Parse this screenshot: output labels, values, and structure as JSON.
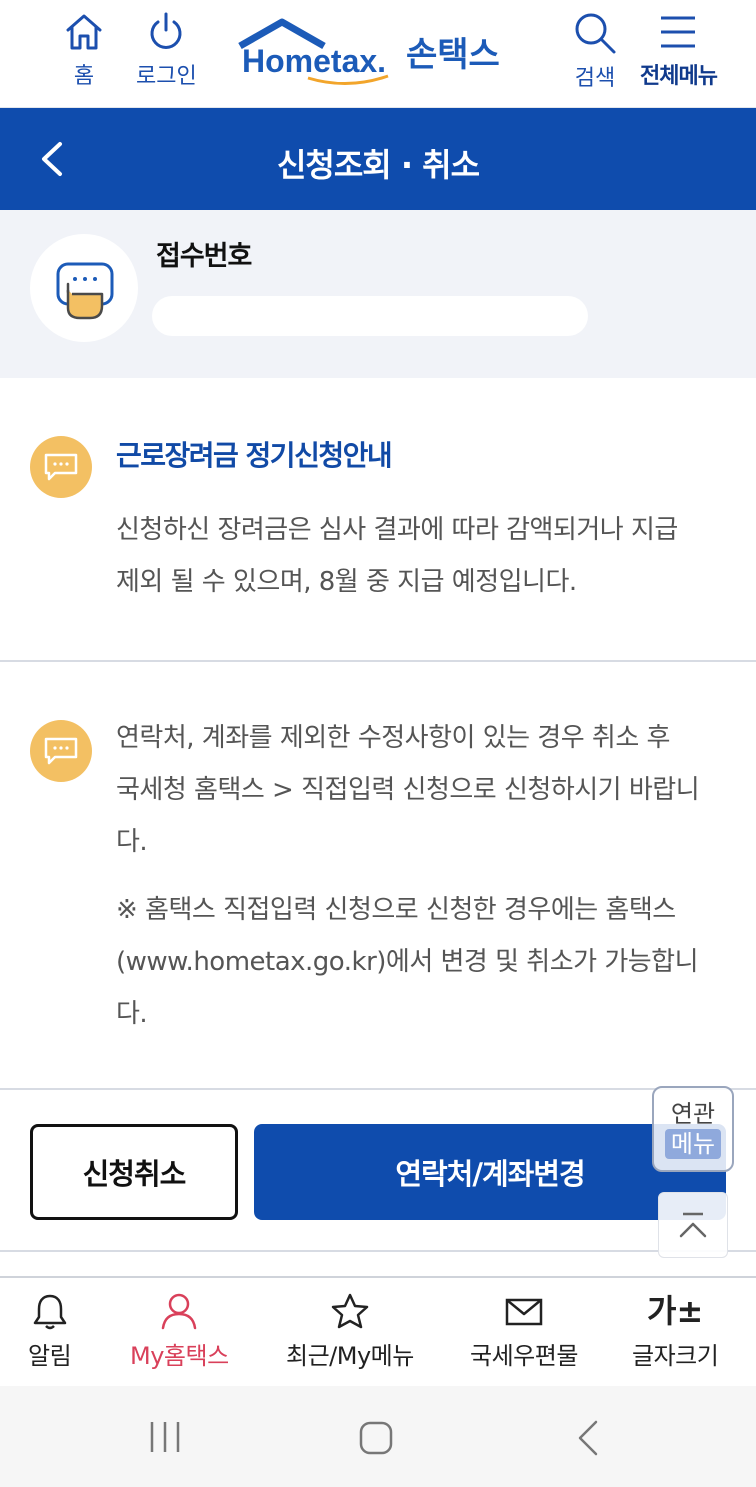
{
  "header": {
    "home_label": "홈",
    "login_label": "로그인",
    "logo_text": "Hometax.",
    "logo_korean": "손택스",
    "search_label": "검색",
    "menu_label": "전체메뉴"
  },
  "title_bar": {
    "title": "신청조회 · 취소"
  },
  "receipt": {
    "label": "접수번호",
    "value": ""
  },
  "notices": [
    {
      "title": "근로장려금 정기신청안내",
      "lines": [
        "신청하신 장려금은 심사 결과에 따라 감액되거나 지급",
        "제외 될 수 있으며, 8월 중 지급 예정입니다."
      ]
    },
    {
      "lines": [
        "연락처, 계좌를 제외한 수정사항이 있는 경우 취소 후",
        "국세청 홈택스 > 직접입력 신청으로 신청하시기 바랍니",
        "다."
      ],
      "note_lines": [
        "※ 홈택스 직접입력 신청으로 신청한 경우에는 홈택스",
        "(www.hometax.go.kr)에서 변경 및 취소가 가능합니",
        "다."
      ]
    }
  ],
  "actions": {
    "cancel_label": "신청취소",
    "change_label": "연락처/계좌변경"
  },
  "floating": {
    "related_line1": "연관",
    "related_line2": "메뉴"
  },
  "bottom_nav": [
    {
      "label": "알림",
      "icon": "bell-icon"
    },
    {
      "label": "My홈택스",
      "icon": "person-icon",
      "active": true
    },
    {
      "label": "최근/My메뉴",
      "icon": "star-icon"
    },
    {
      "label": "국세우편물",
      "icon": "mail-icon"
    },
    {
      "label": "글자크기",
      "icon": "font-size-icon",
      "glyph": "가±"
    }
  ],
  "colors": {
    "brand_blue": "#0f4cad",
    "notice_icon": "#f3c063",
    "active_nav": "#d9405a"
  }
}
